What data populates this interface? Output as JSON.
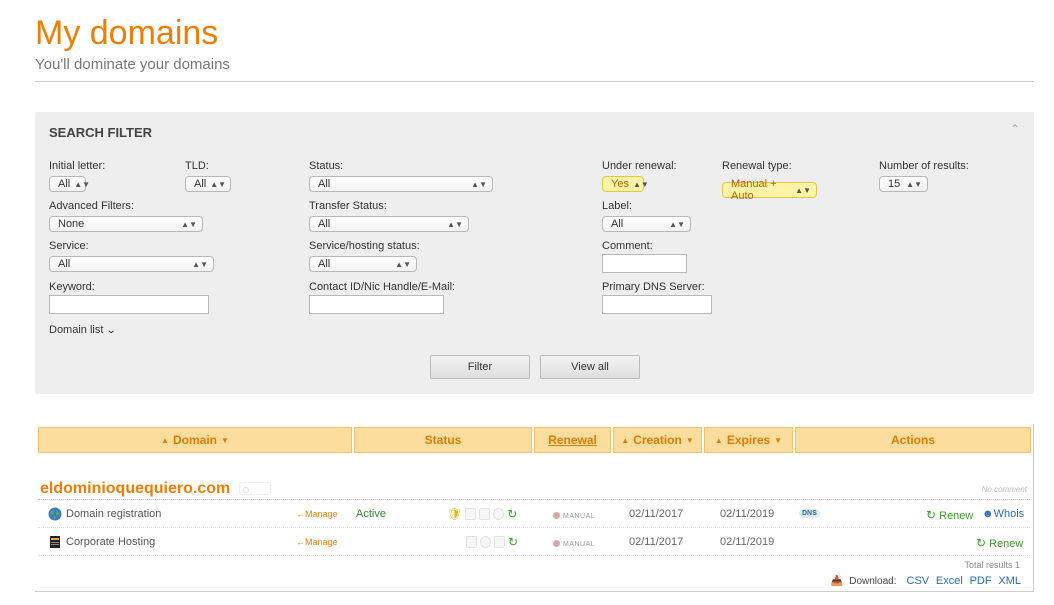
{
  "header": {
    "title": "My domains",
    "subtitle": "You'll dominate your domains"
  },
  "filter": {
    "title": "SEARCH FILTER",
    "collapse_icon": "chevron-up-icon",
    "fields": {
      "initial_letter": {
        "label": "Initial letter:",
        "value": "All"
      },
      "tld": {
        "label": "TLD:",
        "value": "All"
      },
      "status": {
        "label": "Status:",
        "value": "All"
      },
      "under_renewal": {
        "label": "Under renewal:",
        "value": "Yes"
      },
      "renewal_type": {
        "label": "Renewal type:",
        "value": "Manual + Auto"
      },
      "number_of_results": {
        "label": "Number of results:",
        "value": "15"
      },
      "advanced_filters": {
        "label": "Advanced Filters:",
        "value": "None"
      },
      "transfer_status": {
        "label": "Transfer Status:",
        "value": "All"
      },
      "label": {
        "label": "Label:",
        "value": "All"
      },
      "service": {
        "label": "Service:",
        "value": "All"
      },
      "service_hosting_status": {
        "label": "Service/hosting status:",
        "value": "All"
      },
      "comment": {
        "label": "Comment:",
        "value": ""
      },
      "keyword": {
        "label": "Keyword:",
        "value": ""
      },
      "contact_id": {
        "label": "Contact ID/Nic Handle/E-Mail:",
        "value": ""
      },
      "primary_dns": {
        "label": "Primary DNS Server:",
        "value": ""
      }
    },
    "domain_list_label": "Domain list",
    "filter_button": "Filter",
    "view_all_button": "View all"
  },
  "table": {
    "columns": {
      "domain": "Domain",
      "status": "Status",
      "renewal": "Renewal",
      "creation": "Creation",
      "expires": "Expires",
      "actions": "Actions"
    },
    "domain": {
      "name": "eldominioquequiero.com",
      "comment": "No comment"
    },
    "rows": [
      {
        "service": "Domain registration",
        "manage": "←Manage",
        "status": "Active",
        "renewal": "MANUAL",
        "creation": "02/11/2017",
        "expires": "02/11/2019",
        "dns_badge": "DNS",
        "action_renew": "Renew",
        "action_whois": "Whois"
      },
      {
        "service": "Corporate Hosting",
        "manage": "←Manage",
        "status": "",
        "renewal": "MANUAL",
        "creation": "02/11/2017",
        "expires": "02/11/2019",
        "action_renew": "Renew"
      }
    ],
    "total_results": "Total results 1",
    "download_label": "Download:",
    "download_formats": [
      "CSV",
      "Excel",
      "PDF",
      "XML"
    ]
  },
  "colors": {
    "accent": "#f07d00",
    "header_bg": "#fddd9e",
    "active": "#2e8b2e",
    "link": "#2a6db5",
    "highlight_select": "#fff3a8"
  }
}
